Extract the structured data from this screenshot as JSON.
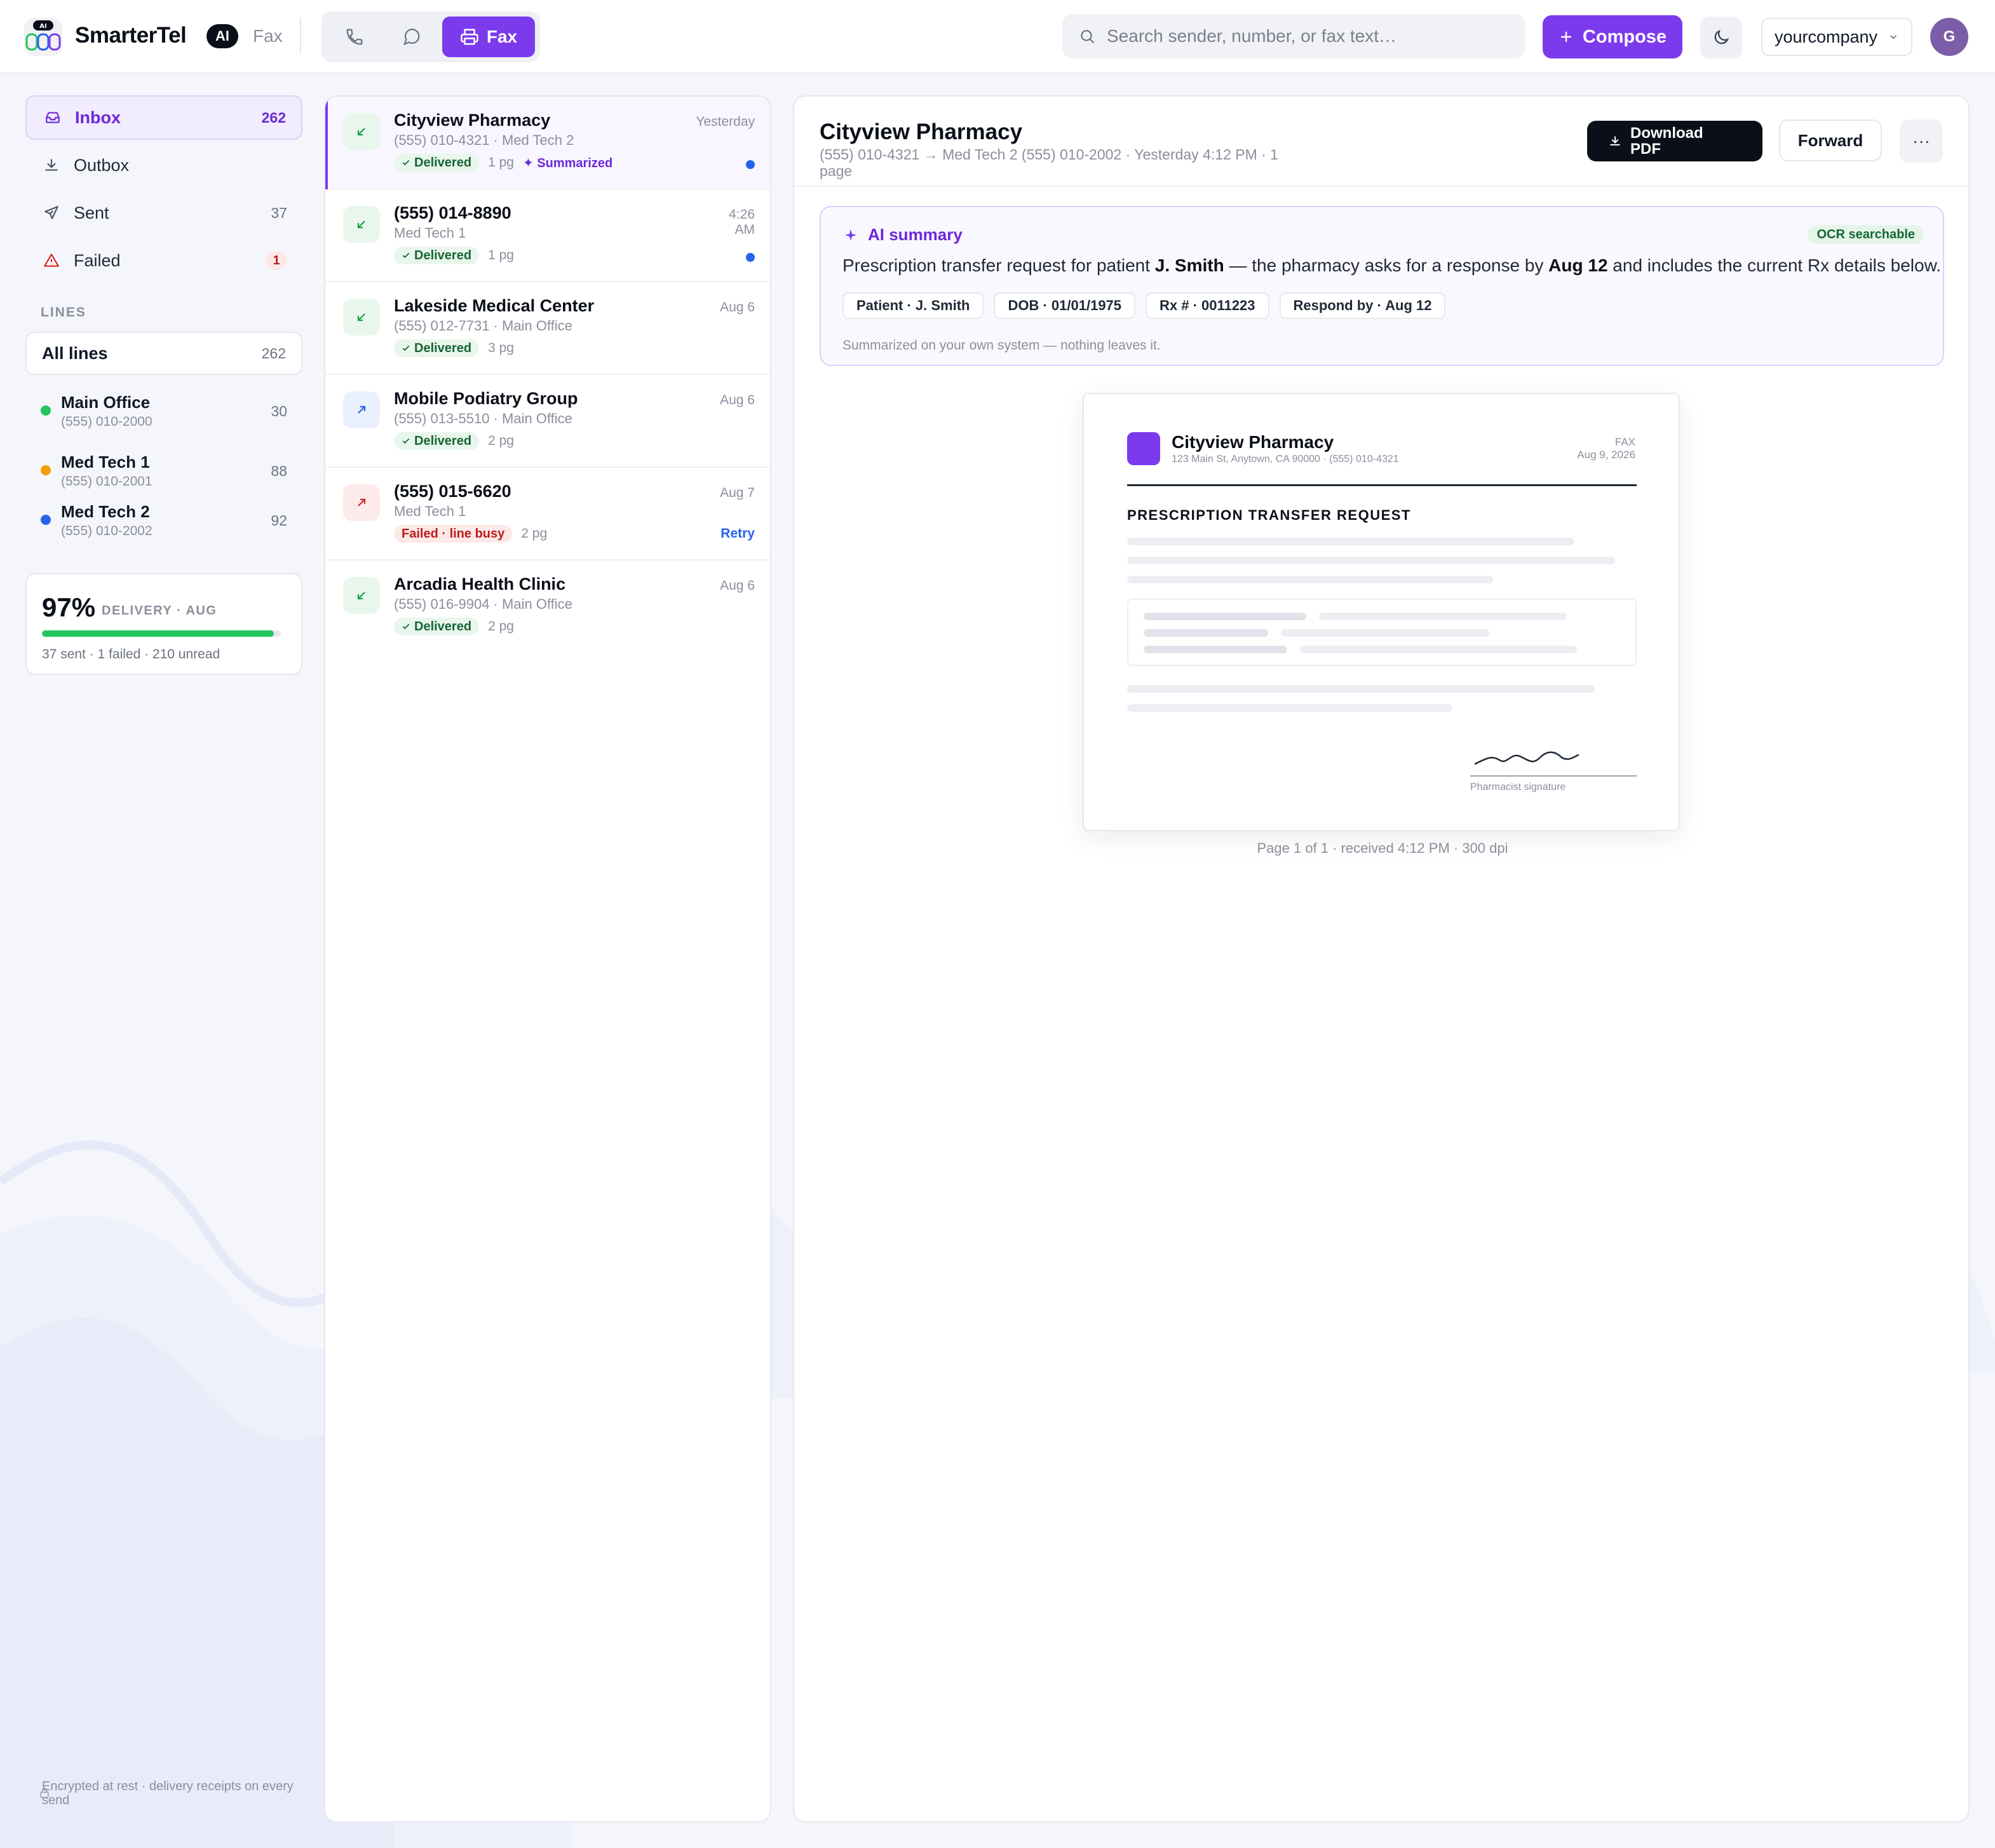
{
  "app": {
    "name": "SmarterTel",
    "ai_badge": "AI",
    "section": "Fax",
    "logo_badge": "AI"
  },
  "modes": {
    "active_label": "Fax"
  },
  "search": {
    "placeholder": "Search sender, number, or fax text…"
  },
  "compose_label": "Compose",
  "company": "yourcompany",
  "avatar_initial": "G",
  "nav": [
    {
      "label": "Inbox",
      "count": "262",
      "icon": "inbox-icon"
    },
    {
      "label": "Outbox",
      "count": "",
      "icon": "download-icon"
    },
    {
      "label": "Sent",
      "count": "37",
      "icon": "send-icon"
    },
    {
      "label": "Failed",
      "count": "1",
      "icon": "warning-icon"
    }
  ],
  "lines_header": "LINES",
  "all_lines": {
    "label": "All lines",
    "count": "262"
  },
  "lines": [
    {
      "name": "Main Office",
      "number": "(555) 010-2000",
      "count": "30",
      "color": "#22c55e"
    },
    {
      "name": "Med Tech 1",
      "number": "(555) 010-2001",
      "count": "88",
      "color": "#f59e0b"
    },
    {
      "name": "Med Tech 2",
      "number": "(555) 010-2002",
      "count": "92",
      "color": "#2563eb"
    }
  ],
  "stats": {
    "percent": "97%",
    "label": "DELIVERY · AUG",
    "delivery_fraction": 0.97,
    "summary": "37 sent · 1 failed · 210 unread"
  },
  "footer_note": "Encrypted at rest · delivery receipts on every send",
  "faxes": [
    {
      "name": "Cityview Pharmacy",
      "sub": "(555) 010-4321 · Med Tech 2",
      "time": "Yesterday",
      "status": "Delivered",
      "pages": "1 pg",
      "tag": "Summarized",
      "direction": "in"
    },
    {
      "name": "(555) 014-8890",
      "sub": "Med Tech 1",
      "time": "4:26 AM",
      "status": "Delivered",
      "pages": "1 pg",
      "direction": "in"
    },
    {
      "name": "Lakeside Medical Center",
      "sub": "(555) 012-7731 · Main Office",
      "time": "Aug 6",
      "status": "Delivered",
      "pages": "3 pg",
      "direction": "in"
    },
    {
      "name": "Mobile Podiatry Group",
      "sub": "(555) 013-5510 · Main Office",
      "time": "Aug 6",
      "status": "Delivered",
      "pages": "2 pg",
      "direction": "out"
    },
    {
      "name": "(555) 015-6620",
      "sub": "Med Tech 1",
      "time": "Aug 7",
      "status": "Failed · line busy",
      "pages": "2 pg",
      "action": "Retry",
      "direction": "failed"
    },
    {
      "name": "Arcadia Health Clinic",
      "sub": "(555) 016-9904 · Main Office",
      "time": "Aug 6",
      "status": "Delivered",
      "pages": "2 pg",
      "direction": "in"
    }
  ],
  "detail": {
    "title": "Cityview Pharmacy",
    "sub": "(555) 010-4321 → Med Tech 2 (555) 010-2002 · Yesterday 4:12 PM · 1 page",
    "download_label": "Download PDF",
    "forward_label": "Forward",
    "more_label": "···",
    "ai": {
      "header": "AI summary",
      "ocr": "OCR searchable",
      "text_pre": "Prescription transfer request for patient ",
      "patient": "J. Smith",
      "text_mid": " — the pharmacy asks for a response by ",
      "due": "Aug 12",
      "text_post": " and includes the current Rx details below.",
      "chips": [
        "Patient · J. Smith",
        "DOB · 01/01/1975",
        "Rx # · 0011223",
        "Respond by · Aug 12"
      ],
      "note": "Summarized on your own system — nothing leaves it."
    },
    "doc": {
      "name": "Cityview Pharmacy",
      "address": "123 Main St, Anytown, CA 90000 · (555) 010-4321",
      "fax_label": "FAX",
      "date": "Aug 9, 2026",
      "title": "PRESCRIPTION TRANSFER REQUEST",
      "signature_label": "Pharmacist signature"
    },
    "page_info": "Page 1 of 1 · received 4:12 PM · 300 dpi"
  },
  "colors": {
    "accent": "#7c3aed",
    "success": "#22c55e",
    "danger": "#b91c1c",
    "link": "#2563eb"
  }
}
